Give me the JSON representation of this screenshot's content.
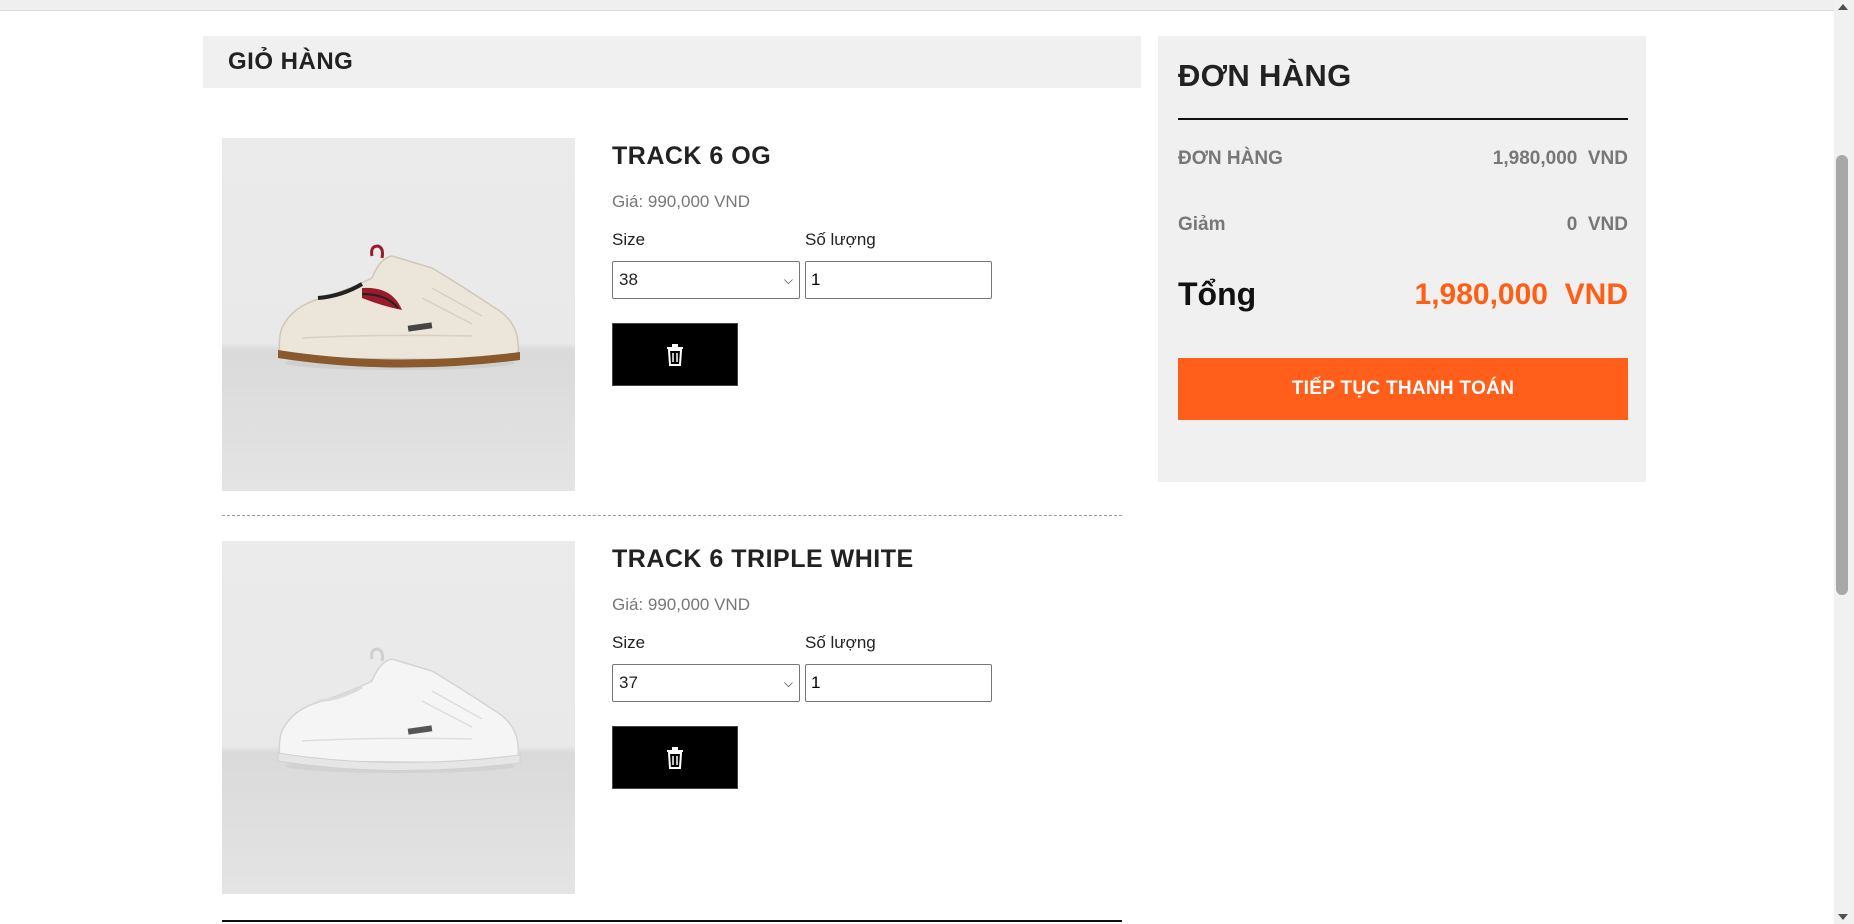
{
  "cart": {
    "title": "GIỎ HÀNG",
    "items": [
      {
        "name": "TRACK 6 OG",
        "price": "Giá: 990,000 VND",
        "size_label": "Size",
        "qty_label": "Số lượng",
        "size_value": "38",
        "qty_value": "1",
        "delete_icon": "trash-icon",
        "image": "sneaker-cream-red-accent"
      },
      {
        "name": "TRACK 6 TRIPLE WHITE",
        "price": "Giá: 990,000 VND",
        "size_label": "Size",
        "qty_label": "Số lượng",
        "size_value": "37",
        "qty_value": "1",
        "delete_icon": "trash-icon",
        "image": "sneaker-all-white"
      }
    ]
  },
  "order": {
    "title": "ĐƠN HÀNG",
    "subtotal_label": "ĐƠN HÀNG",
    "subtotal_value": "1,980,000  VND",
    "discount_label": "Giảm",
    "discount_value": "0  VND",
    "total_label": "Tổng",
    "total_value": "1,980,000  VND",
    "checkout_label": "TIẾP TỤC THANH TOÁN"
  },
  "colors": {
    "accent": "#ff5e1b",
    "panel_bg": "#f0f0f0",
    "delete_button": "#000000"
  }
}
